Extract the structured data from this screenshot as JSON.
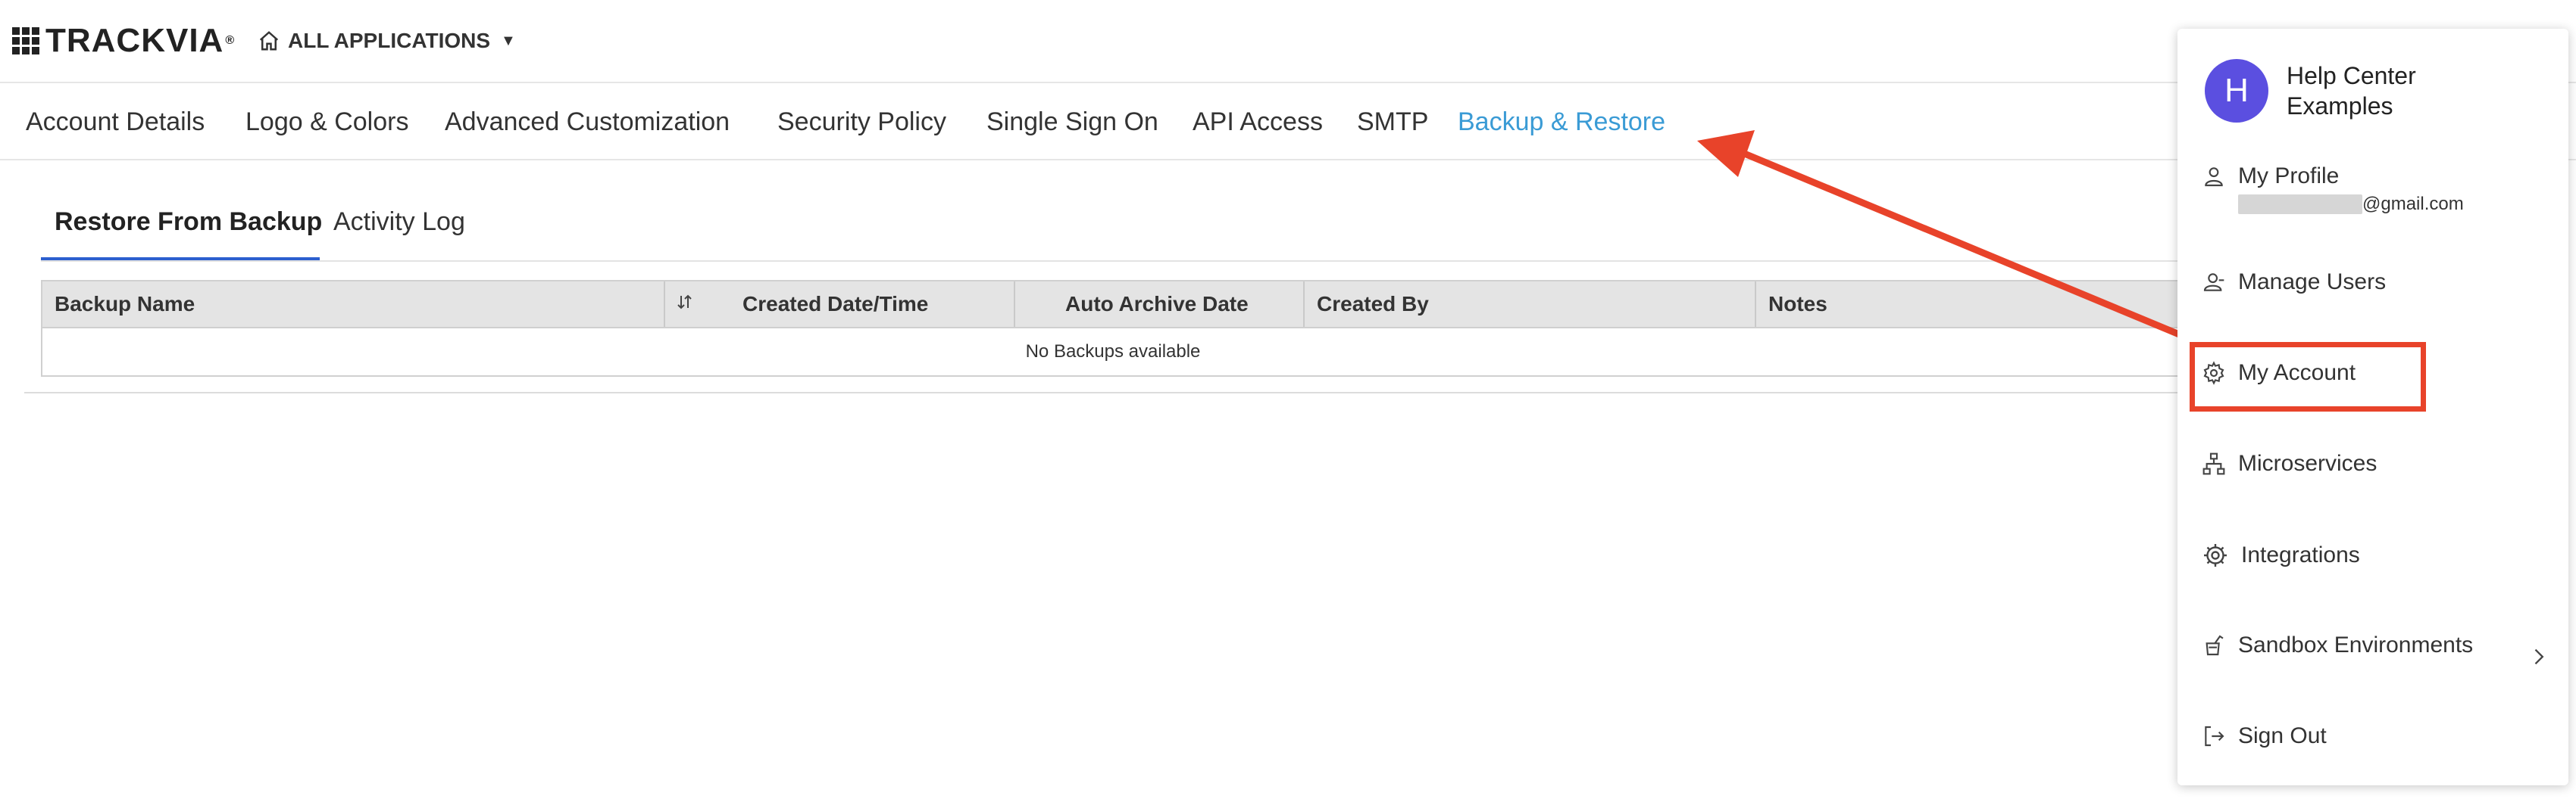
{
  "topbar": {
    "logo_text": "TRACKVIA",
    "logo_reg": "®",
    "app_switcher_label": "ALL APPLICATIONS",
    "app_switcher_caret": "▼"
  },
  "nav": {
    "items": [
      {
        "label": "Account Details"
      },
      {
        "label": "Logo & Colors"
      },
      {
        "label": "Advanced Customization"
      },
      {
        "label": "Security Policy"
      },
      {
        "label": "Single Sign On"
      },
      {
        "label": "API Access"
      },
      {
        "label": "SMTP"
      },
      {
        "label": "Backup & Restore",
        "active": true
      }
    ],
    "active_color": "#3a9bd5"
  },
  "subtabs": {
    "items": [
      {
        "label": "Restore From Backup",
        "active": true
      },
      {
        "label": "Activity Log"
      }
    ],
    "underline_color": "#2c5fcf"
  },
  "table": {
    "columns": [
      "Backup Name",
      "Created Date/Time",
      "Auto Archive Date",
      "Created By",
      "Notes"
    ],
    "empty_message": "No Backups available"
  },
  "menu": {
    "avatar_letter": "H",
    "avatar_color": "#5b4fe0",
    "user_name": "Help Center Examples",
    "items": [
      {
        "label": "My Profile",
        "icon": "person-icon"
      },
      {
        "label": "Manage Users",
        "icon": "users-icon"
      },
      {
        "label": "My Account",
        "icon": "gear-icon",
        "highlighted": true
      },
      {
        "label": "Microservices",
        "icon": "hierarchy-icon"
      },
      {
        "label": "Integrations",
        "icon": "integrations-icon"
      },
      {
        "label": "Sandbox Environments",
        "icon": "sandbox-icon",
        "has_submenu": true
      },
      {
        "label": "Sign Out",
        "icon": "sign-out-icon"
      }
    ],
    "email_suffix": "@gmail.com"
  },
  "annotation": {
    "color": "#e8432a"
  }
}
